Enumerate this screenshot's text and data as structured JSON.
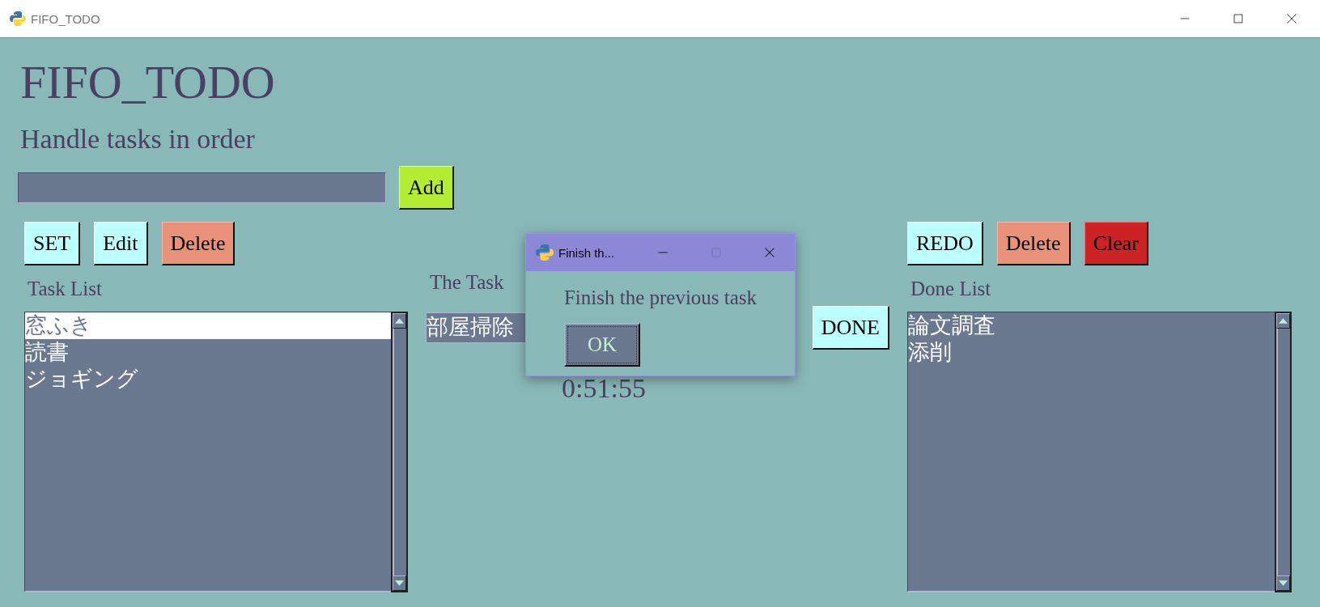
{
  "window": {
    "title": "FIFO_TODO"
  },
  "app": {
    "heading": "FIFO_TODO",
    "subtitle": "Handle tasks in order",
    "add_button": "Add"
  },
  "task_panel": {
    "buttons": [
      {
        "label": "SET",
        "kind": "plain"
      },
      {
        "label": "Edit",
        "kind": "plain"
      },
      {
        "label": "Delete",
        "kind": "warning"
      }
    ],
    "label": "Task List",
    "items": [
      {
        "text": "窓ふき",
        "selected": true
      },
      {
        "text": "読書",
        "selected": false
      },
      {
        "text": "ジョギング",
        "selected": false
      }
    ]
  },
  "current_panel": {
    "label": "The Task",
    "task": "部屋掃除",
    "timer": "0:51:55",
    "button": "DONE"
  },
  "done_panel": {
    "buttons": [
      {
        "label": "REDO",
        "kind": "plain"
      },
      {
        "label": "Delete",
        "kind": "warning"
      },
      {
        "label": "Clear",
        "kind": "danger"
      }
    ],
    "label": "Done List",
    "items": [
      {
        "text": "論文調査",
        "selected": false
      },
      {
        "text": "添削",
        "selected": false
      }
    ]
  },
  "dialog": {
    "title": "Finish th...",
    "message": "Finish the previous task",
    "button": "OK"
  }
}
